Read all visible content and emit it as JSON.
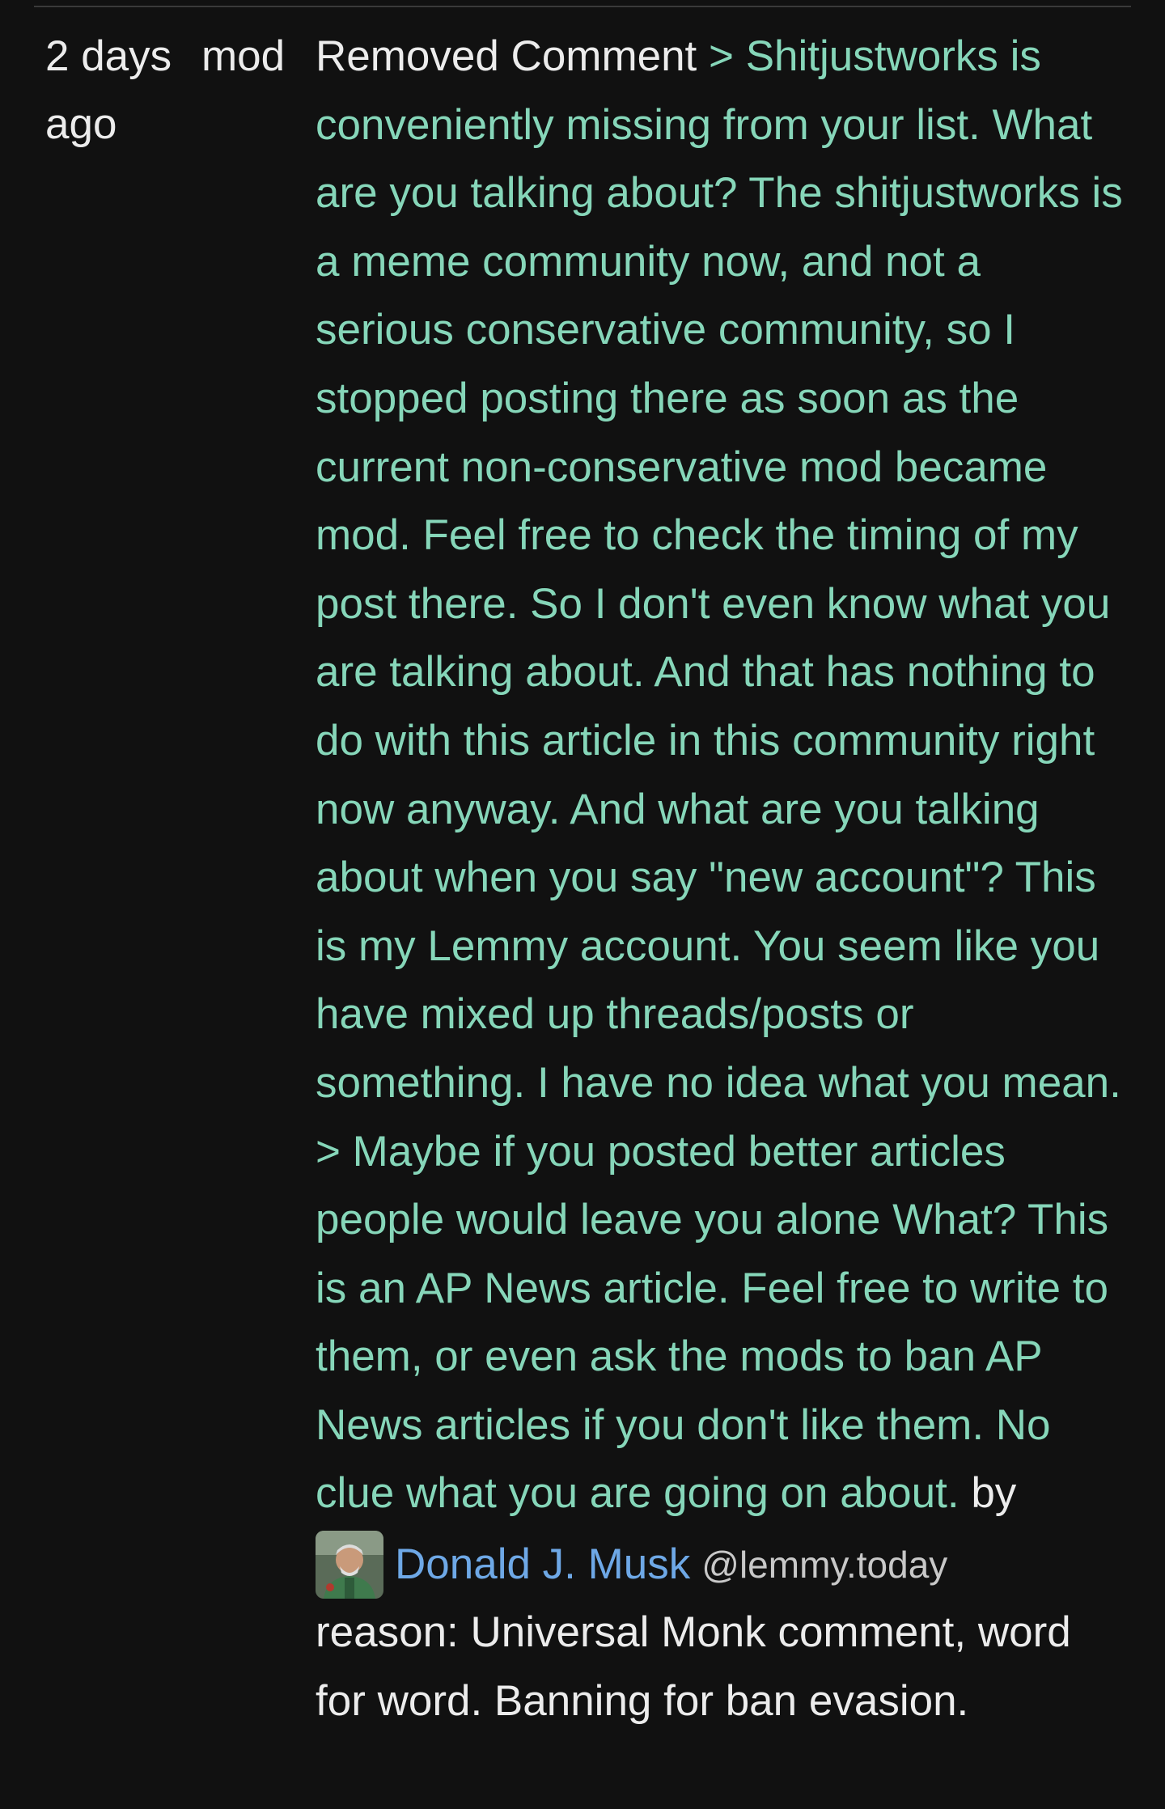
{
  "entry": {
    "when": "2 days ago",
    "actor": "mod",
    "action": "Removed Comment",
    "comment_text": "> Shitjustworks is conveniently missing from your list. What are you talking about? The shitjustworks is a meme community now, and not a serious conservative community, so I stopped posting there as soon as the current non-conservative mod became mod. Feel free to check the timing of my post there. So I don't even know what you are talking about. And that has nothing to do with this article in this community right now anyway. And what are you talking about when you say \"new account\"? This is my Lemmy account. You seem like you have mixed up threads/posts or something. I have no idea what you mean. > Maybe if you posted better articles people would leave you alone What? This is an AP News article. Feel free to write to them, or even ask the mods to ban AP News articles if you don't like them. No clue what you are going on about.",
    "by_label": "by",
    "author": {
      "name": "Donald J. Musk",
      "instance": "@lemmy.today",
      "avatar_icon": "user-avatar-icon"
    },
    "reason": "reason: Universal Monk comment, word for word. Banning for ban evasion."
  },
  "colors": {
    "background": "#111111",
    "text": "#ececec",
    "quote": "#86d6b9",
    "link": "#6ea8e6",
    "muted": "#c8c8c8"
  }
}
